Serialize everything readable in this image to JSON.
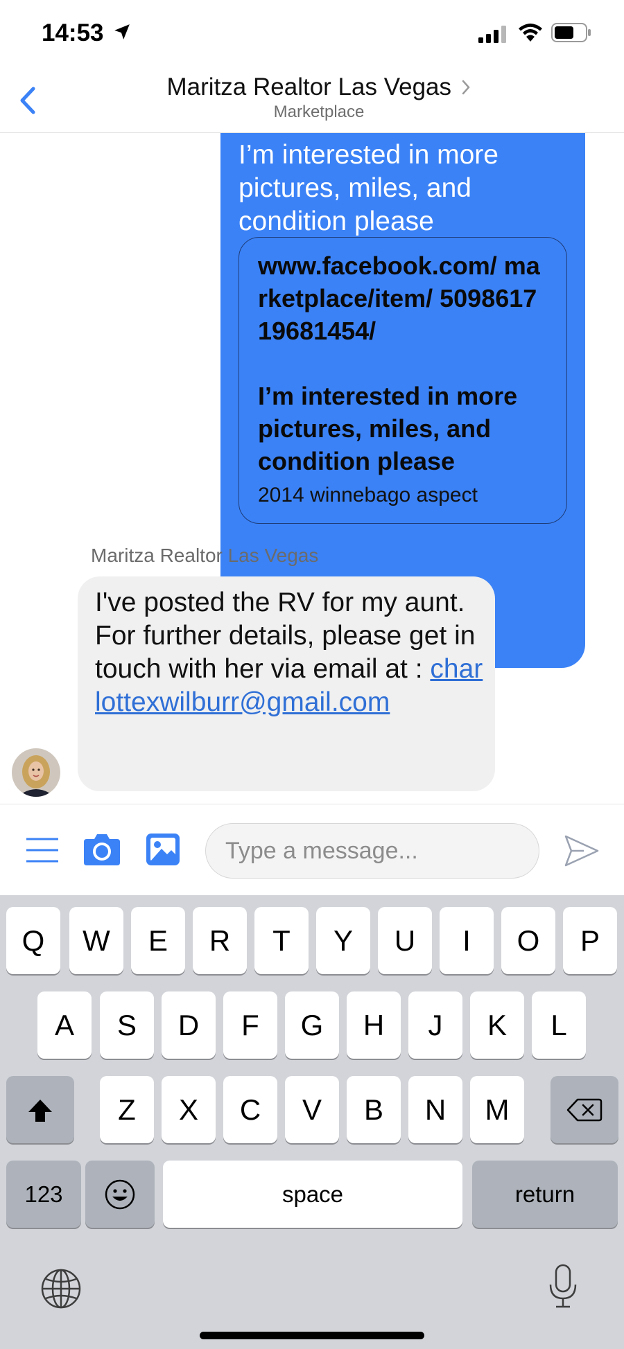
{
  "status_bar": {
    "time": "14:53"
  },
  "header": {
    "title": "Maritza Realtor Las Vegas",
    "subtitle": "Marketplace"
  },
  "messages": {
    "sent": {
      "text": "I’m interested in more pictures, miles, and condition please",
      "share_link": "www.facebook.com/ marketplace/item/ 509861719681454/",
      "share_message": "I’m interested in more pictures, miles, and condition please",
      "share_description": "2014 winnebago aspect"
    },
    "received": {
      "sender": "Maritza Realtor Las Vegas",
      "text": "I've posted the RV for my aunt. For further details, please get in touch with her via email at :",
      "email": "charlottexwilburr@gmail.com"
    }
  },
  "composer": {
    "placeholder": "Type a message..."
  },
  "keyboard": {
    "row1": [
      "Q",
      "W",
      "E",
      "R",
      "T",
      "Y",
      "U",
      "I",
      "O",
      "P"
    ],
    "row2": [
      "A",
      "S",
      "D",
      "F",
      "G",
      "H",
      "J",
      "K",
      "L"
    ],
    "row3": [
      "Z",
      "X",
      "C",
      "V",
      "B",
      "N",
      "M"
    ],
    "numbers_label": "123",
    "space_label": "space",
    "return_label": "return"
  },
  "colors": {
    "accent": "#3b82f6",
    "link": "#2f6fd6",
    "keyboard_bg": "#d2d4d9"
  }
}
